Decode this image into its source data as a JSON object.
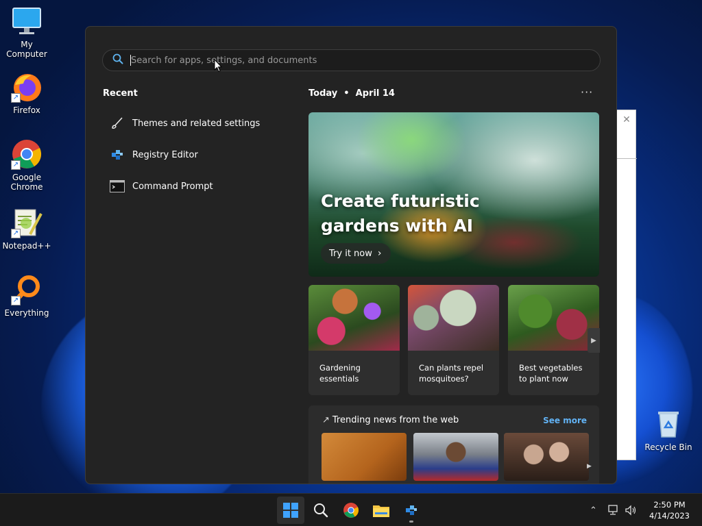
{
  "desktop": {
    "icons": [
      {
        "label": "My Computer",
        "icon": "monitor-icon"
      },
      {
        "label": "Firefox",
        "icon": "firefox-icon"
      },
      {
        "label": "Google Chrome",
        "icon": "chrome-icon"
      },
      {
        "label": "Notepad++",
        "icon": "notepadpp-icon"
      },
      {
        "label": "Everything",
        "icon": "everything-icon"
      },
      {
        "label": "Recycle Bin",
        "icon": "recycle-bin-icon"
      }
    ]
  },
  "start": {
    "search": {
      "placeholder": "Search for apps, settings, and documents",
      "value": ""
    },
    "recent_title": "Recent",
    "recent": [
      {
        "label": "Themes and related settings",
        "icon": "brush-icon"
      },
      {
        "label": "Registry Editor",
        "icon": "registry-icon"
      },
      {
        "label": "Command Prompt",
        "icon": "terminal-icon"
      }
    ],
    "today_label": "Today",
    "today_date": "April 14",
    "more_label": "···",
    "hero": {
      "title": "Create futuristic gardens with AI",
      "button": "Try it now"
    },
    "cards": [
      {
        "caption": "Gardening essentials"
      },
      {
        "caption": "Can plants repel mosquitoes?"
      },
      {
        "caption": "Best vegetables to plant now"
      }
    ],
    "trending": {
      "title": "Trending news from the web",
      "see_more": "See more"
    }
  },
  "taskbar": {
    "clock_time": "2:50 PM",
    "clock_date": "4/14/2023",
    "colors": {
      "accent": "#3fa3ff",
      "link": "#62b3f5"
    }
  }
}
